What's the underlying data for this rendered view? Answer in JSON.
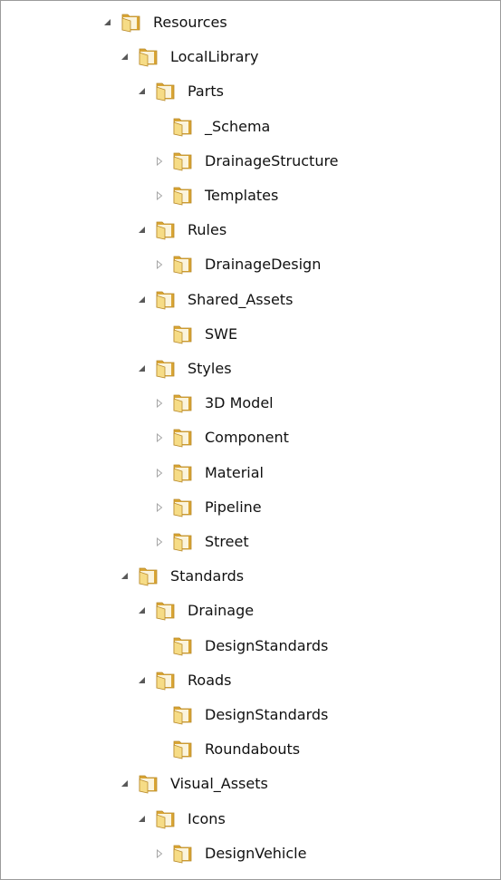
{
  "tree": {
    "nodes": [
      {
        "label": "Resources",
        "depth": 0,
        "state": "expanded"
      },
      {
        "label": "LocalLibrary",
        "depth": 1,
        "state": "expanded"
      },
      {
        "label": "Parts",
        "depth": 2,
        "state": "expanded"
      },
      {
        "label": "_Schema",
        "depth": 3,
        "state": "leaf"
      },
      {
        "label": "DrainageStructure",
        "depth": 3,
        "state": "collapsed"
      },
      {
        "label": "Templates",
        "depth": 3,
        "state": "collapsed"
      },
      {
        "label": "Rules",
        "depth": 2,
        "state": "expanded"
      },
      {
        "label": "DrainageDesign",
        "depth": 3,
        "state": "collapsed"
      },
      {
        "label": "Shared_Assets",
        "depth": 2,
        "state": "expanded"
      },
      {
        "label": "SWE",
        "depth": 3,
        "state": "leaf"
      },
      {
        "label": "Styles",
        "depth": 2,
        "state": "expanded"
      },
      {
        "label": "3D Model",
        "depth": 3,
        "state": "collapsed"
      },
      {
        "label": "Component",
        "depth": 3,
        "state": "collapsed"
      },
      {
        "label": "Material",
        "depth": 3,
        "state": "collapsed"
      },
      {
        "label": "Pipeline",
        "depth": 3,
        "state": "collapsed"
      },
      {
        "label": "Street",
        "depth": 3,
        "state": "collapsed"
      },
      {
        "label": "Standards",
        "depth": 1,
        "state": "expanded"
      },
      {
        "label": "Drainage",
        "depth": 2,
        "state": "expanded"
      },
      {
        "label": "DesignStandards",
        "depth": 3,
        "state": "leaf"
      },
      {
        "label": "Roads",
        "depth": 2,
        "state": "expanded"
      },
      {
        "label": "DesignStandards",
        "depth": 3,
        "state": "leaf"
      },
      {
        "label": "Roundabouts",
        "depth": 3,
        "state": "leaf"
      },
      {
        "label": "Visual_Assets",
        "depth": 1,
        "state": "expanded"
      },
      {
        "label": "Icons",
        "depth": 2,
        "state": "expanded"
      },
      {
        "label": "DesignVehicle",
        "depth": 3,
        "state": "collapsed"
      }
    ]
  },
  "icons": {
    "expanded": "expanded-arrow-icon",
    "collapsed": "collapsed-arrow-icon",
    "folder": "folder-icon"
  },
  "colors": {
    "folder_light": "#f6dc86",
    "folder_dark": "#d9a534",
    "folder_edge": "#b98a2a",
    "arrow_expanded": "#595959",
    "arrow_collapsed": "#a6a6a6"
  }
}
